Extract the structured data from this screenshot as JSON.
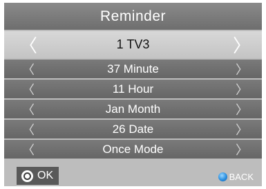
{
  "title": "Reminder",
  "rows": [
    {
      "label": "1 TV3",
      "left_arrow": "〈",
      "right_arrow": "〉"
    },
    {
      "label": "37 Minute",
      "left_arrow": "〈",
      "right_arrow": "〉"
    },
    {
      "label": "11 Hour",
      "left_arrow": "〈",
      "right_arrow": "〉"
    },
    {
      "label": "Jan Month",
      "left_arrow": "〈",
      "right_arrow": "〉"
    },
    {
      "label": "26 Date",
      "left_arrow": "〈",
      "right_arrow": "〉"
    },
    {
      "label": "Once Mode",
      "left_arrow": "〈",
      "right_arrow": "〉"
    }
  ],
  "footer": {
    "ok_label": "OK",
    "ok_icon": "ok-circle-icon",
    "back_label": "BACK",
    "back_icon": "blue-circle-icon",
    "back_icon_color": "#2a8fe0"
  },
  "colors": {
    "selected_row": "#cfcfcf",
    "row": "#707070",
    "title_bar": "#7c7c7c",
    "panel": "#bdbdbd"
  }
}
